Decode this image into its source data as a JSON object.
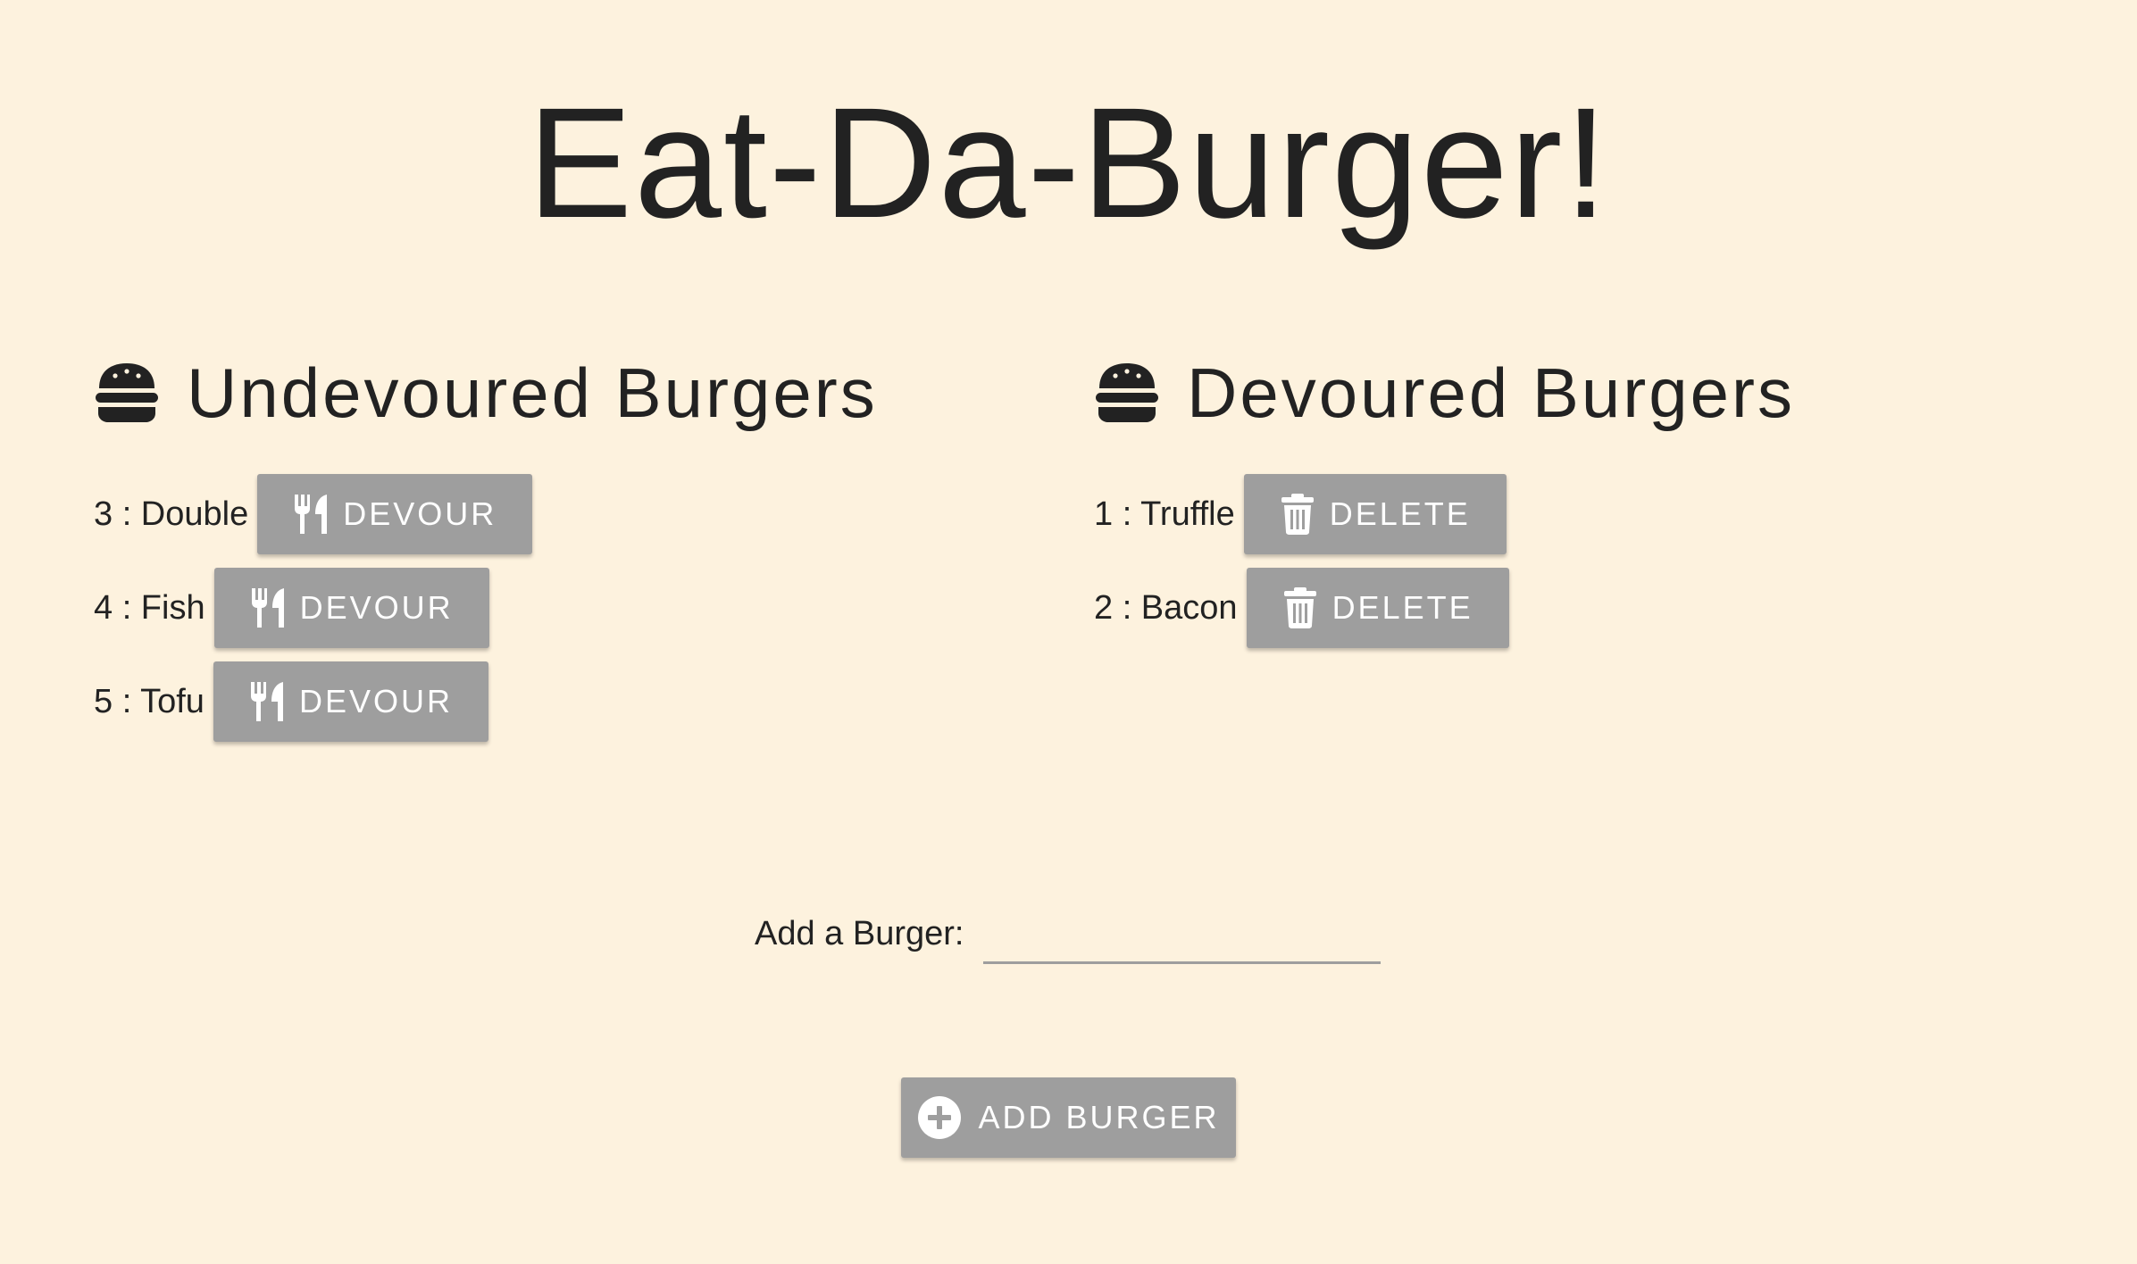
{
  "header": {
    "title": "Eat-Da-Burger!"
  },
  "undevoured": {
    "heading": "Undevoured Burgers",
    "icon": "burger-icon",
    "items": [
      {
        "label": "3 : Double",
        "button_label": "DEVOUR",
        "button_icon": "utensils-icon"
      },
      {
        "label": "4 : Fish",
        "button_label": "DEVOUR",
        "button_icon": "utensils-icon"
      },
      {
        "label": "5 : Tofu",
        "button_label": "DEVOUR",
        "button_icon": "utensils-icon"
      }
    ]
  },
  "devoured": {
    "heading": "Devoured Burgers",
    "icon": "burger-icon",
    "items": [
      {
        "label": "1 : Truffle",
        "button_label": "DELETE",
        "button_icon": "trash-icon"
      },
      {
        "label": "2 : Bacon",
        "button_label": "DELETE",
        "button_icon": "trash-icon"
      }
    ]
  },
  "add_form": {
    "label": "Add a Burger:",
    "input_value": "",
    "button_label": "ADD BURGER",
    "button_icon": "plus-circle-icon"
  },
  "colors": {
    "background": "#fdf2de",
    "button": "#9e9e9e",
    "text": "#222222"
  }
}
